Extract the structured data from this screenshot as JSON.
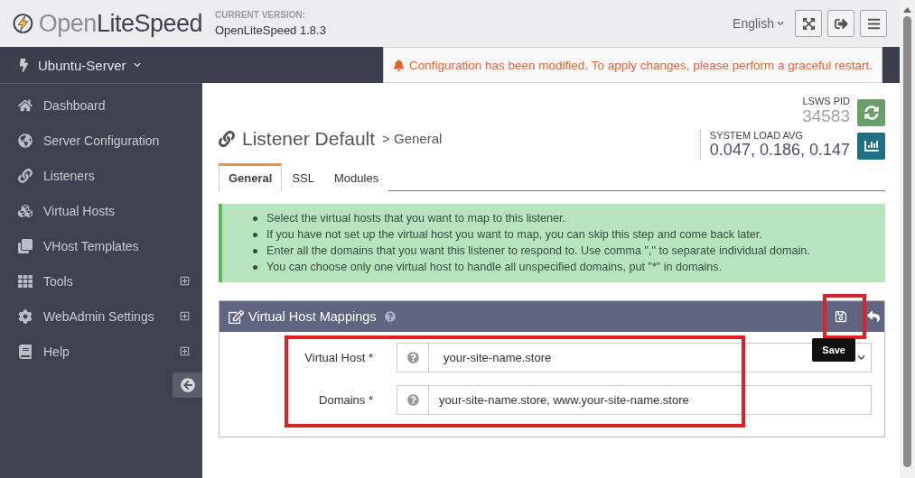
{
  "header": {
    "logo_light": "Open",
    "logo_bold": "LiteSpeed",
    "version_label": "CURRENT VERSION:",
    "version": "OpenLiteSpeed 1.8.3",
    "language": "English"
  },
  "top_bar": {
    "server": "Ubuntu-Server",
    "alert": "Configuration has been modified. To apply changes, please perform a graceful restart."
  },
  "sidebar": {
    "items": [
      {
        "label": "Dashboard",
        "expandable": false
      },
      {
        "label": "Server Configuration",
        "expandable": false
      },
      {
        "label": "Listeners",
        "expandable": false
      },
      {
        "label": "Virtual Hosts",
        "expandable": false
      },
      {
        "label": "VHost Templates",
        "expandable": false
      },
      {
        "label": "Tools",
        "expandable": true
      },
      {
        "label": "WebAdmin Settings",
        "expandable": true
      },
      {
        "label": "Help",
        "expandable": true
      }
    ]
  },
  "page": {
    "title": "Listener Default",
    "breadcrumb": "> General",
    "pid_label": "LSWS PID",
    "pid": "34583",
    "load_label": "SYSTEM LOAD AVG",
    "load": "0.047, 0.186, 0.147"
  },
  "tabs": [
    {
      "label": "General",
      "selected": true
    },
    {
      "label": "SSL",
      "selected": false
    },
    {
      "label": "Modules",
      "selected": false
    }
  ],
  "notes": [
    "Select the virtual hosts that you want to map to this listener.",
    "If you have not set up the virtual host you want to map, you can skip this step and come back later.",
    "Enter all the domains that you want this listener to respond to. Use comma \",\" to separate individual domain.",
    "You can choose only one virtual host to handle all unspecified domains, put \"*\" in domains."
  ],
  "panel": {
    "title": "Virtual Host Mappings",
    "tooltip": "Save",
    "fields": [
      {
        "label": "Virtual Host *",
        "kind": "select",
        "value": "your-site-name.store"
      },
      {
        "label": "Domains *",
        "kind": "text",
        "value": "your-site-name.store, www.your-site-name.store"
      }
    ]
  }
}
